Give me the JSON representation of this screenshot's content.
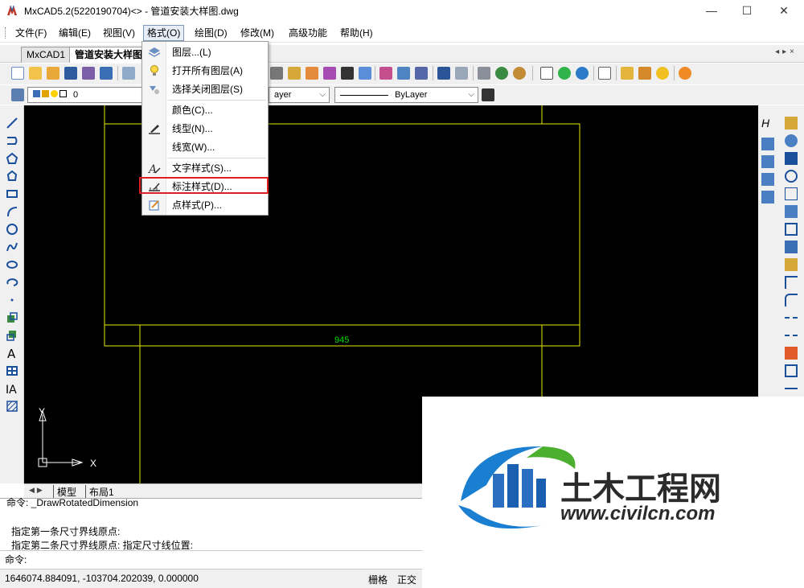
{
  "window": {
    "title": "MxCAD5.2(5220190704)<> - 管道安装大样图.dwg",
    "controls": {
      "minimize": "—",
      "maximize": "☐",
      "close": "✕"
    }
  },
  "menubar": {
    "items": [
      "文件(F)",
      "编辑(E)",
      "视图(V)",
      "格式(O)",
      "绘图(D)",
      "修改(M)",
      "高级功能",
      "帮助(H)"
    ]
  },
  "tabs": {
    "items": [
      "MxCAD1",
      "管道安装大样图"
    ],
    "arrows": "◂▸×"
  },
  "toolbar2": {
    "layer_value": "0",
    "linetype_value": "ayer",
    "lineweight_value": "ByLayer"
  },
  "format_menu": {
    "items": [
      "图层...(L)",
      "打开所有图层(A)",
      "选择关闭图层(S)",
      "颜色(C)...",
      "线型(N)...",
      "线宽(W)...",
      "文字样式(S)...",
      "标注样式(D)...",
      "点样式(P)..."
    ]
  },
  "canvas": {
    "dimension_text": "945",
    "ucs_x": "X",
    "ucs_y": "Y",
    "colors": {
      "background": "#000000",
      "geometry": "#e8e800",
      "dimension": "#00e000"
    }
  },
  "layout_tabs": {
    "model": "模型",
    "layout1": "布局1"
  },
  "command": {
    "lines": [
      "命令: _DrawRotatedDimension",
      "指定第一条尺寸界线原点:",
      "指定第二条尺寸界线原点:  指定尺寸线位置:"
    ],
    "prompt": "命令:"
  },
  "statusbar": {
    "coords": "1646074.884091,  -103704.202039,  0.000000",
    "grid": "栅格",
    "ortho": "正交"
  },
  "watermark": {
    "name": "土木工程网",
    "url": "www.civilcn.com"
  },
  "highlight_color": "#e02020"
}
